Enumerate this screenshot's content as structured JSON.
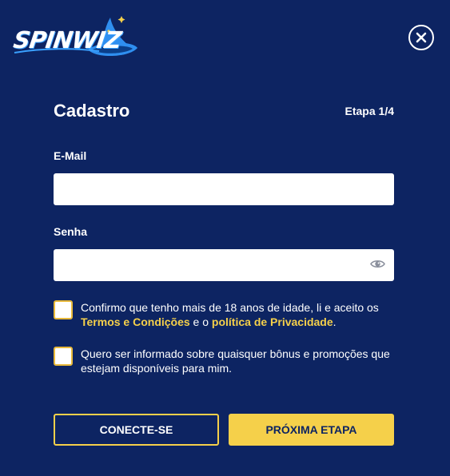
{
  "brand": {
    "logo_text": "SPINWIZ"
  },
  "header": {
    "close_icon": "close-icon"
  },
  "form": {
    "title": "Cadastro",
    "step": "Etapa 1/4",
    "email_label": "E-Mail",
    "email_value": "",
    "password_label": "Senha",
    "password_value": "",
    "password_icon": "eye-icon"
  },
  "consent": {
    "age": {
      "text_before": "Confirmo que tenho mais de 18 anos de idade, li e aceito os ",
      "terms_link": "Termos e Condições",
      "text_middle": " e o ",
      "privacy_link": "política de Privacidade",
      "text_after": "."
    },
    "marketing": {
      "text": "Quero ser informado sobre quaisquer bônus e promoções que estejam disponíveis para mim."
    }
  },
  "actions": {
    "login_label": "CONECTE-SE",
    "next_label": "PRÓXIMA ETAPA"
  },
  "colors": {
    "background": "#0d2462",
    "accent": "#f5d04a",
    "input": "#ffffff"
  }
}
